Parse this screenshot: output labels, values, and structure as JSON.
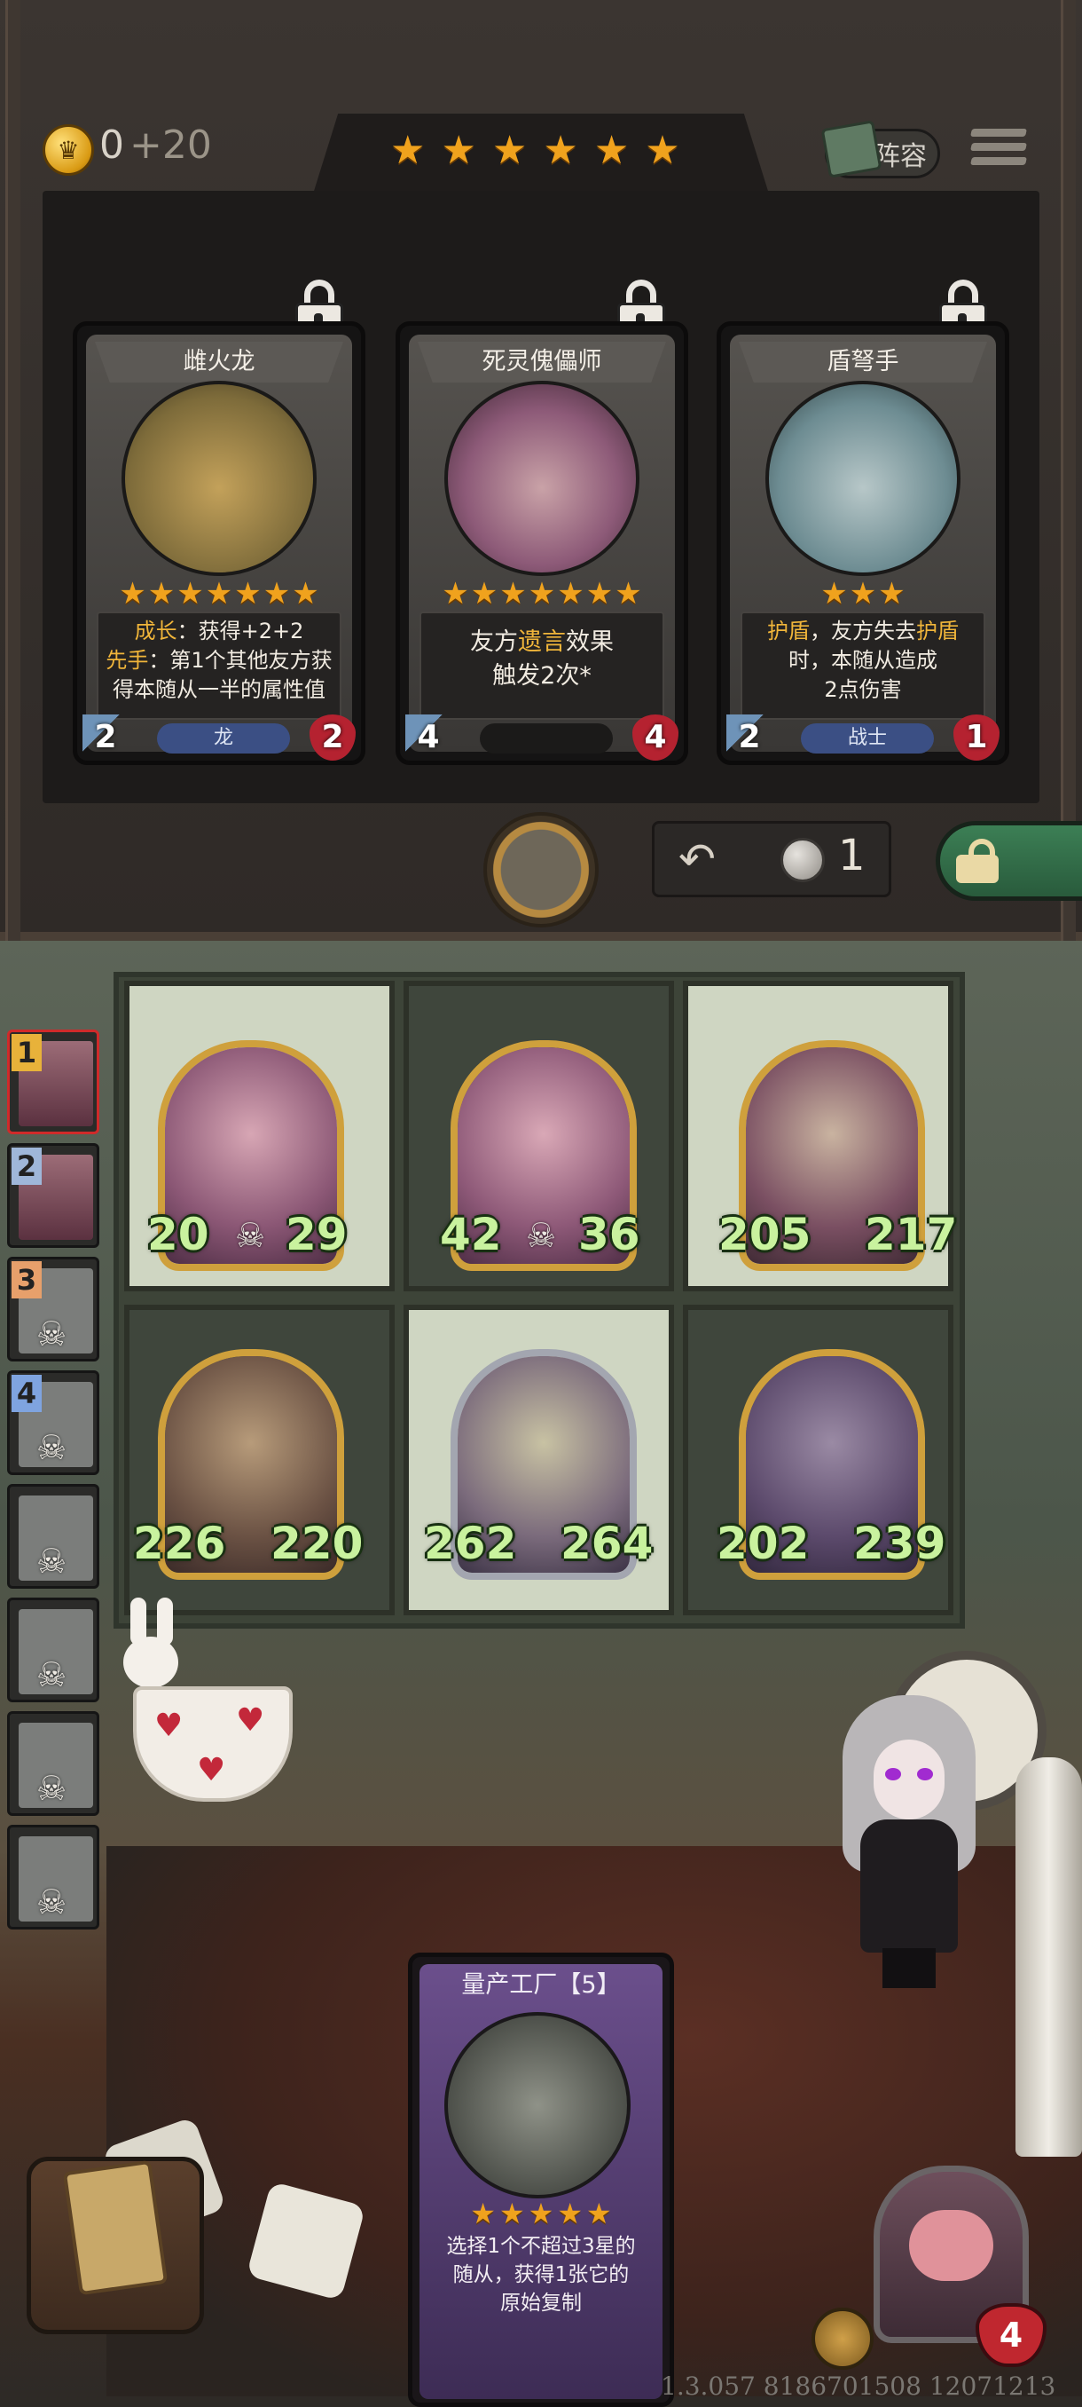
{
  "header": {
    "gold": "0",
    "gold_income": "+20",
    "tavern_stars": 6,
    "lineup_label": "阵容"
  },
  "shop": {
    "cards": [
      {
        "name": "雌火龙",
        "stars": 7,
        "attack": "2",
        "health": "2",
        "tribe": "龙",
        "locked": true,
        "desc_line1_kw": "成长",
        "desc_line1_rest": "：获得+2+2",
        "desc_line2_kw": "先手",
        "desc_line2_rest": "：第1个其他友方获",
        "desc_line3": "得本随从一半的属性值"
      },
      {
        "name": "死灵傀儡师",
        "stars": 7,
        "attack": "4",
        "health": "4",
        "tribe": "",
        "locked": true,
        "desc_line1_pre": "友方",
        "desc_line1_kw": "遗言",
        "desc_line1_post": "效果",
        "desc_line2": "触发2次*"
      },
      {
        "name": "盾弩手",
        "stars": 3,
        "attack": "2",
        "health": "1",
        "tribe": "战士",
        "locked": true,
        "desc_line1_kw": "护盾",
        "desc_line1_mid": "，友方失去",
        "desc_line1_kw2": "护盾",
        "desc_line2": "时，本随从造成",
        "desc_line3": "2点伤害"
      }
    ],
    "refresh_cost": "1"
  },
  "board": {
    "minions": [
      {
        "attack": "20",
        "health": "29",
        "deathrattle": true
      },
      {
        "attack": "42",
        "health": "36",
        "deathrattle": true
      },
      {
        "attack": "205",
        "health": "217",
        "deathrattle": false
      },
      {
        "attack": "226",
        "health": "220",
        "deathrattle": false
      },
      {
        "attack": "262",
        "health": "264",
        "deathrattle": false
      },
      {
        "attack": "202",
        "health": "239",
        "deathrattle": false
      }
    ]
  },
  "ranking": {
    "items": [
      {
        "rank": "1",
        "eliminated": false,
        "active": true
      },
      {
        "rank": "2",
        "eliminated": false,
        "active": false
      },
      {
        "rank": "3",
        "eliminated": true,
        "active": false
      },
      {
        "rank": "4",
        "eliminated": true,
        "active": false
      },
      {
        "rank": "",
        "eliminated": true,
        "active": false
      },
      {
        "rank": "",
        "eliminated": true,
        "active": false
      },
      {
        "rank": "",
        "eliminated": true,
        "active": false
      },
      {
        "rank": "",
        "eliminated": true,
        "active": false
      }
    ],
    "rank_colors": [
      "#e8b23a",
      "#9fb7d9",
      "#e7a06b",
      "#7fa4e0"
    ]
  },
  "factory_card": {
    "title": "量产工厂【5】",
    "stars": 5,
    "desc_line1": "选择1个不超过3星的",
    "desc_line2": "随从，获得1张它的",
    "desc_line3": "原始复制"
  },
  "player": {
    "health": "4"
  },
  "footer": {
    "version": "1.3.057 8186701508 12071213"
  },
  "colors": {
    "star": "#f0a21d",
    "keyword": "#f0b53a",
    "stat_green": "#c9f29e",
    "health_red": "#c0272f"
  },
  "icons": [
    "coin-icon",
    "lineup-icon",
    "menu-icon",
    "lock-icon",
    "refresh-icon",
    "silver-coin-icon",
    "unlock-icon",
    "skull-icon",
    "star-icon",
    "heart-icon"
  ]
}
